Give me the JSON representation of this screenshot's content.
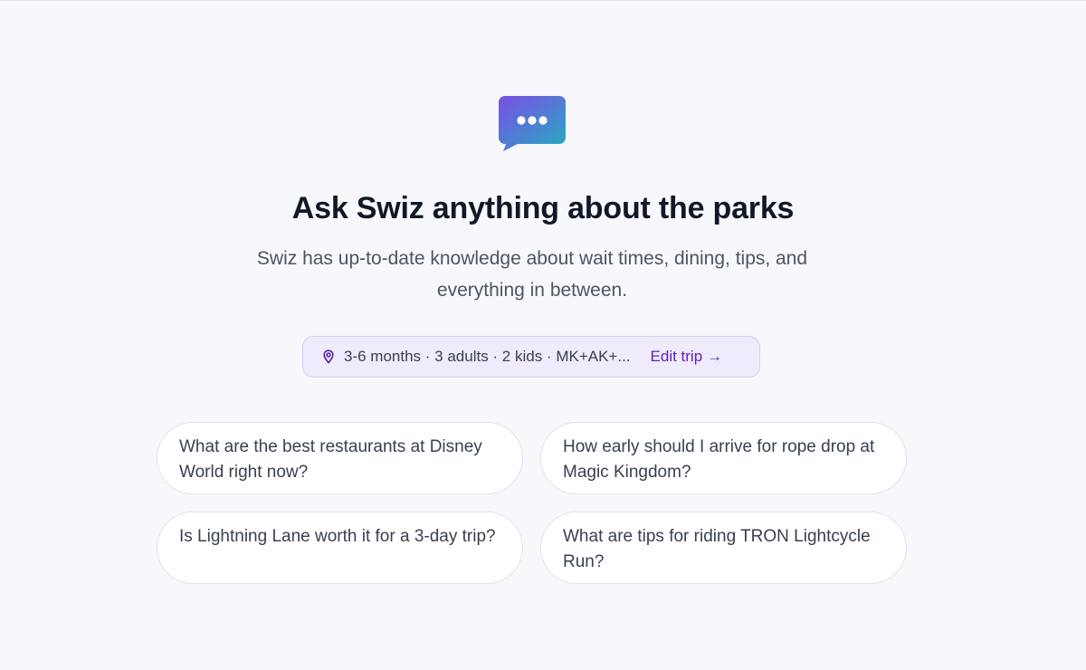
{
  "hero": {
    "title": "Ask Swiz anything about the parks",
    "subtitle": "Swiz has up-to-date knowledge about wait times, dining, tips, and everything in between.",
    "icon": "chat-bubble-icon",
    "icon_gradient": [
      "#7c4ee4",
      "#2aa6c4"
    ]
  },
  "trip": {
    "icon": "map-pin-icon",
    "summary": "3-6 months · 3 adults · 2 kids · MK+AK+...",
    "edit_label": "Edit trip",
    "edit_arrow": "→",
    "accent_color": "#5b21b6"
  },
  "suggestions": [
    {
      "text": "What are the best restaurants at Disney World right now?"
    },
    {
      "text": "How early should I arrive for rope drop at Magic Kingdom?"
    },
    {
      "text": "Is Lightning Lane worth it for a 3-day trip?"
    },
    {
      "text": "What are tips for riding TRON Lightcycle Run?"
    }
  ]
}
